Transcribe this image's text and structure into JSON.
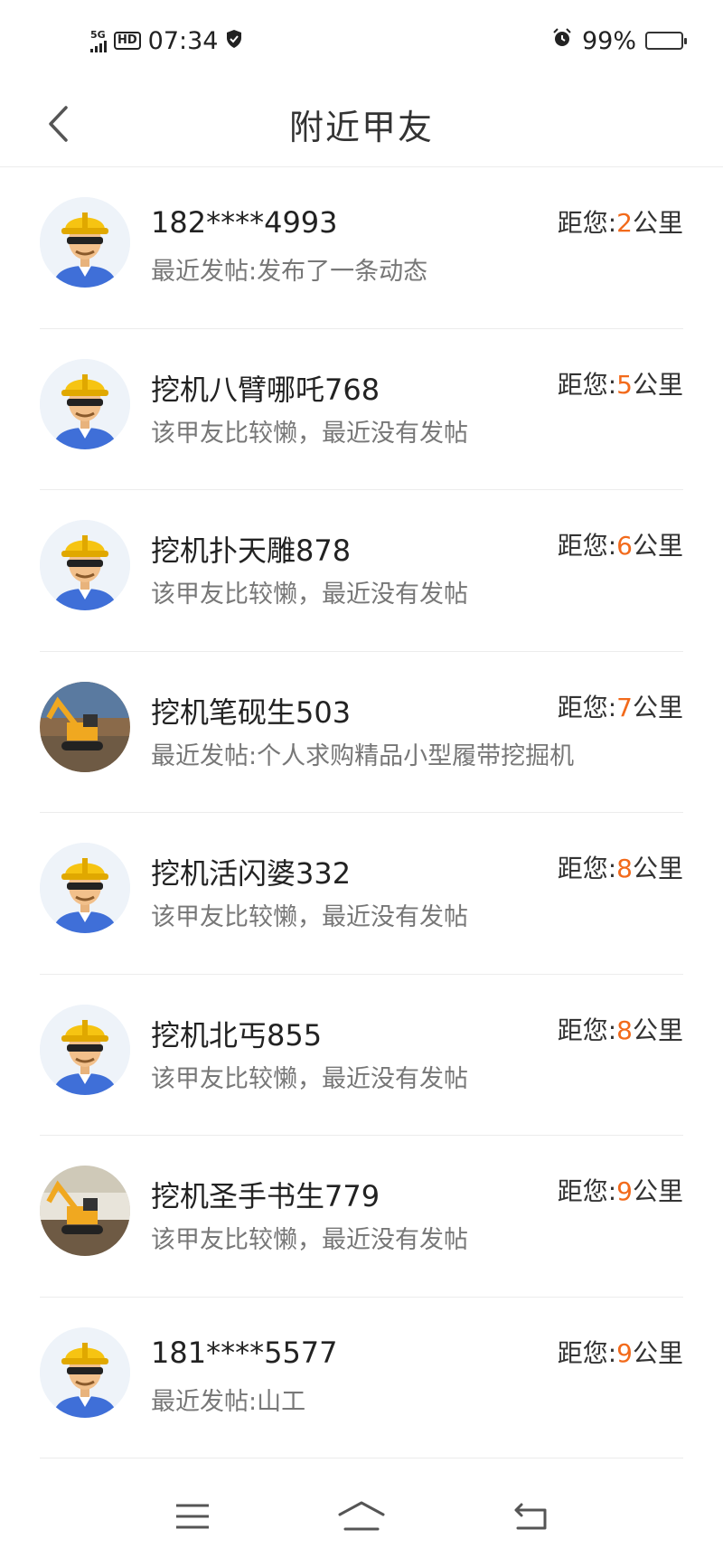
{
  "status_bar": {
    "network": "5G",
    "hd": "HD",
    "time": "07:34",
    "battery": "99%"
  },
  "header": {
    "title": "附近甲友"
  },
  "distance": {
    "prefix": "距您:",
    "unit": "公里",
    "highlight_color": "#f26a1b"
  },
  "list": [
    {
      "name": "182****4993",
      "desc": "最近发帖:发布了一条动态",
      "distance": "2",
      "avatar": "worker-avatar"
    },
    {
      "name": "挖机八臂哪吒768",
      "desc": "该甲友比较懒，最近没有发帖",
      "distance": "5",
      "avatar": "worker-avatar"
    },
    {
      "name": "挖机扑天雕878",
      "desc": "该甲友比较懒，最近没有发帖",
      "distance": "6",
      "avatar": "worker-avatar"
    },
    {
      "name": "挖机笔砚生503",
      "desc": "最近发帖:个人求购精品小型履带挖掘机",
      "distance": "7",
      "avatar": "excavator-photo"
    },
    {
      "name": "挖机活闪婆332",
      "desc": "该甲友比较懒，最近没有发帖",
      "distance": "8",
      "avatar": "worker-avatar"
    },
    {
      "name": "挖机北丐855",
      "desc": "该甲友比较懒，最近没有发帖",
      "distance": "8",
      "avatar": "worker-avatar"
    },
    {
      "name": "挖机圣手书生779",
      "desc": "该甲友比较懒，最近没有发帖",
      "distance": "9",
      "avatar": "excavator-photo-2"
    },
    {
      "name": "181****5577",
      "desc": "最近发帖:山工",
      "distance": "9",
      "avatar": "worker-avatar"
    }
  ]
}
